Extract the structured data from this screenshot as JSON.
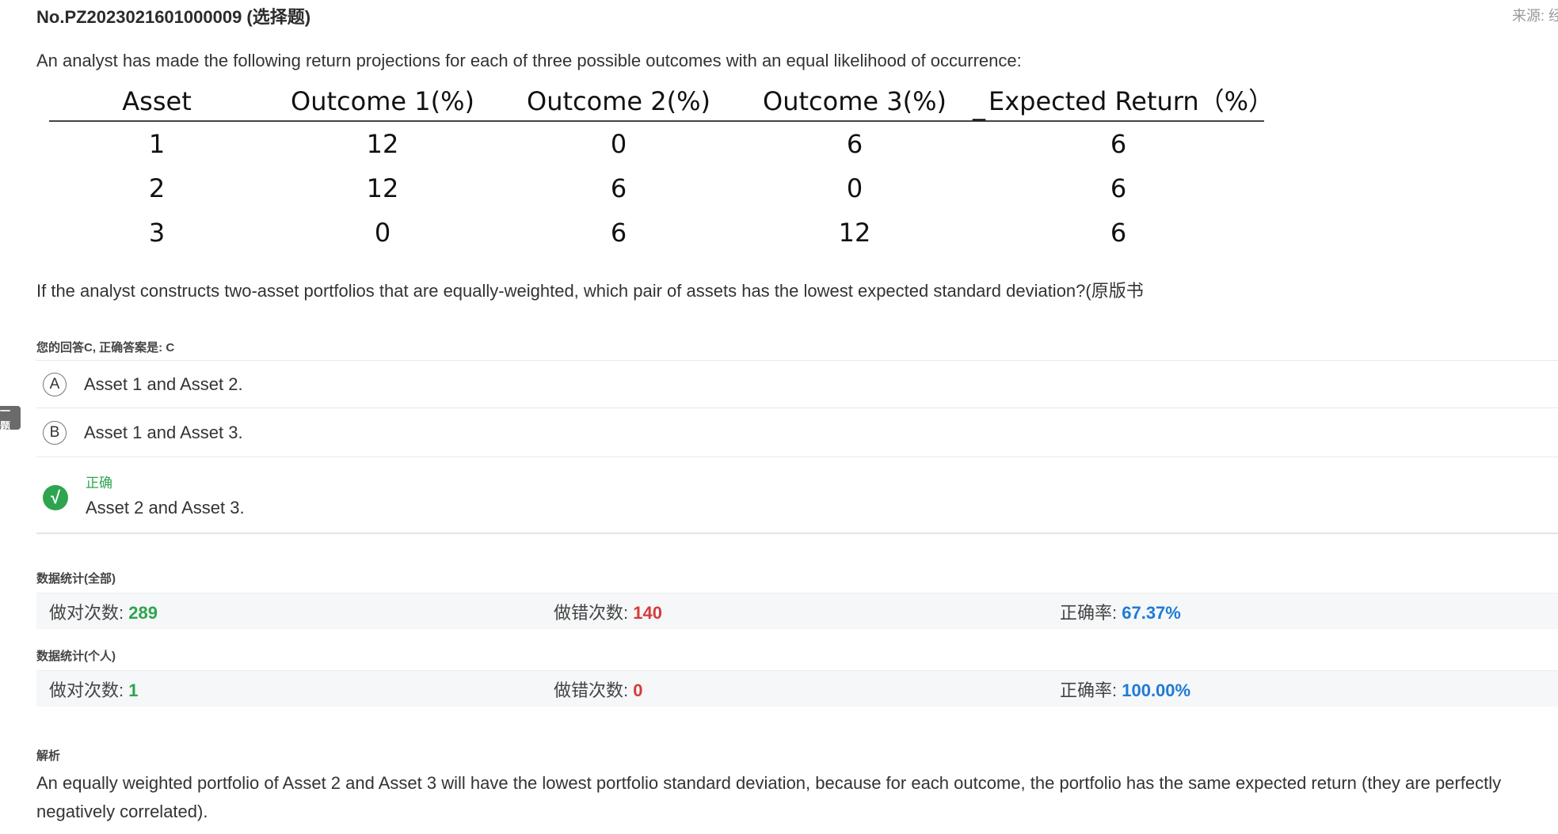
{
  "header": {
    "title": "No.PZ2023021601000009 (选择题)",
    "source": "来源: 经"
  },
  "question": {
    "intro": "An analyst has made the following return projections for each of three possible outcomes with an equal likelihood of occurrence:",
    "table": {
      "headers": [
        "Asset",
        "Outcome 1(%)",
        "Outcome 2(%)",
        "Outcome 3(%)",
        "Expected Return（%）"
      ],
      "rows": [
        [
          "1",
          "12",
          "0",
          "6",
          "6"
        ],
        [
          "2",
          "12",
          "6",
          "0",
          "6"
        ],
        [
          "3",
          "0",
          "6",
          "12",
          "6"
        ]
      ]
    },
    "prompt": "If the analyst constructs two-asset portfolios that are equally-weighted, which pair of assets has the lowest expected standard deviation?(原版书"
  },
  "answer_status": "您的回答C, 正确答案是: C",
  "side_tab": "一题",
  "options": [
    {
      "letter": "A",
      "text": "Asset 1 and Asset 2."
    },
    {
      "letter": "B",
      "text": "Asset 1 and Asset 3."
    },
    {
      "letter": "C",
      "text": "Asset 2 and Asset 3.",
      "correct_label": "正确",
      "check_glyph": "√"
    }
  ],
  "stats_all": {
    "label": "数据统计(全部)",
    "correct_label": "做对次数: ",
    "correct_value": "289",
    "wrong_label": "做错次数: ",
    "wrong_value": "140",
    "rate_label": "正确率: ",
    "rate_value": "67.37%"
  },
  "stats_personal": {
    "label": "数据统计(个人)",
    "correct_label": "做对次数: ",
    "correct_value": "1",
    "wrong_label": "做错次数: ",
    "wrong_value": "0",
    "rate_label": "正确率: ",
    "rate_value": "100.00%"
  },
  "analysis": {
    "label": "解析",
    "text": "An equally weighted portfolio of Asset 2 and Asset 3 will have the lowest portfolio standard deviation, because for each outcome, the portfolio has the same expected return (they are perfectly negatively correlated)."
  },
  "colors": {
    "correct_green": "#2ea44f",
    "wrong_red": "#d73a3a",
    "rate_blue": "#1f7ad6"
  }
}
